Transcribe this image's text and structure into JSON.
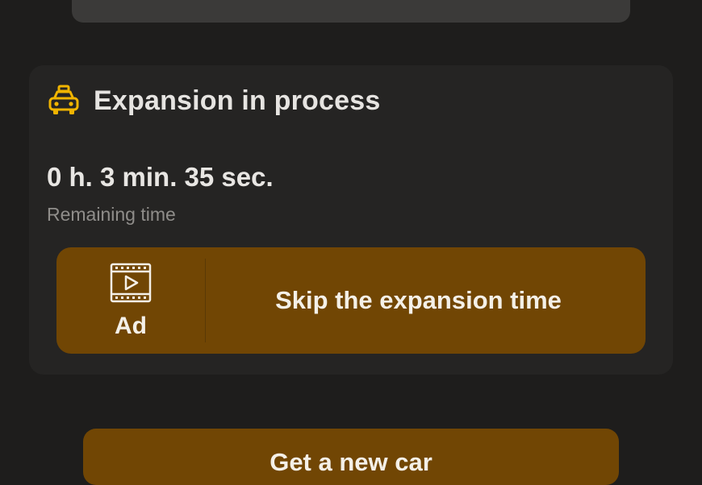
{
  "colors": {
    "background": "#1e1d1c",
    "card": "#252423",
    "accent_button": "#714604",
    "taxi_icon": "#f0b400"
  },
  "expansion_card": {
    "icon": "taxi-icon",
    "title": "Expansion in process",
    "remaining_time": "0 h. 3 min. 35 sec.",
    "remaining_caption": "Remaining time",
    "skip_button": {
      "ad_icon": "film-play-icon",
      "ad_label": "Ad",
      "label": "Skip the expansion time"
    }
  },
  "new_car_button": {
    "label": "Get a new car"
  }
}
